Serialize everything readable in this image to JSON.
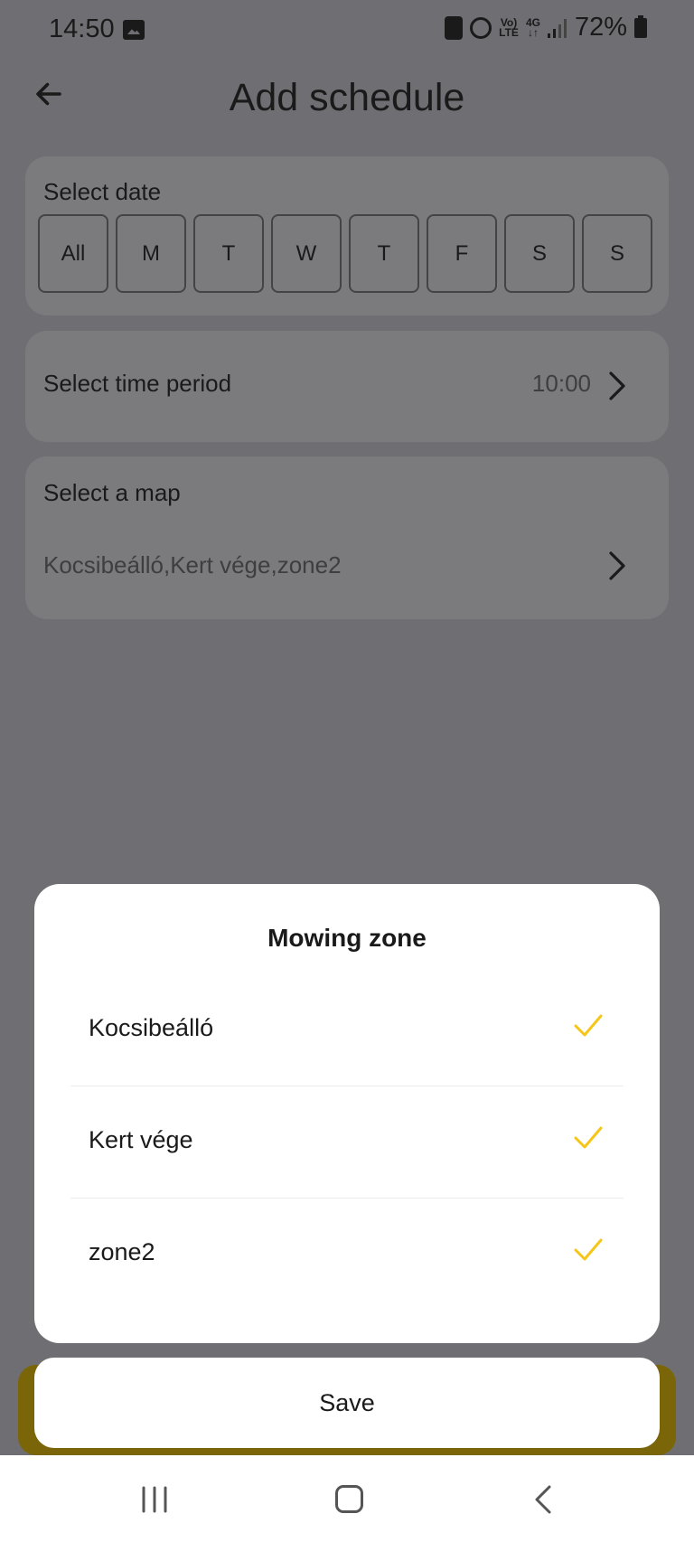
{
  "status_bar": {
    "time": "14:50",
    "net_line1": "Vo)",
    "net_line2": "LTE",
    "data_line1": "4G",
    "data_line2": "↓↑",
    "battery": "72%"
  },
  "header": {
    "title": "Add schedule",
    "back_icon": "arrow-left-icon"
  },
  "date_card": {
    "label": "Select date",
    "days": [
      "All",
      "M",
      "T",
      "W",
      "T",
      "F",
      "S",
      "S"
    ]
  },
  "time_card": {
    "label": "Select time period",
    "value": "10:00"
  },
  "map_card": {
    "label": "Select a map",
    "value": "Kocsibeálló,Kert vége,zone2"
  },
  "dialog": {
    "title": "Mowing zone",
    "zones": [
      {
        "label": "Kocsibeálló",
        "checked": true
      },
      {
        "label": "Kert vége",
        "checked": true
      },
      {
        "label": "zone2",
        "checked": true
      }
    ],
    "save_label": "Save"
  },
  "colors": {
    "accent": "#f5c518",
    "scrim": "#6f6f73"
  }
}
